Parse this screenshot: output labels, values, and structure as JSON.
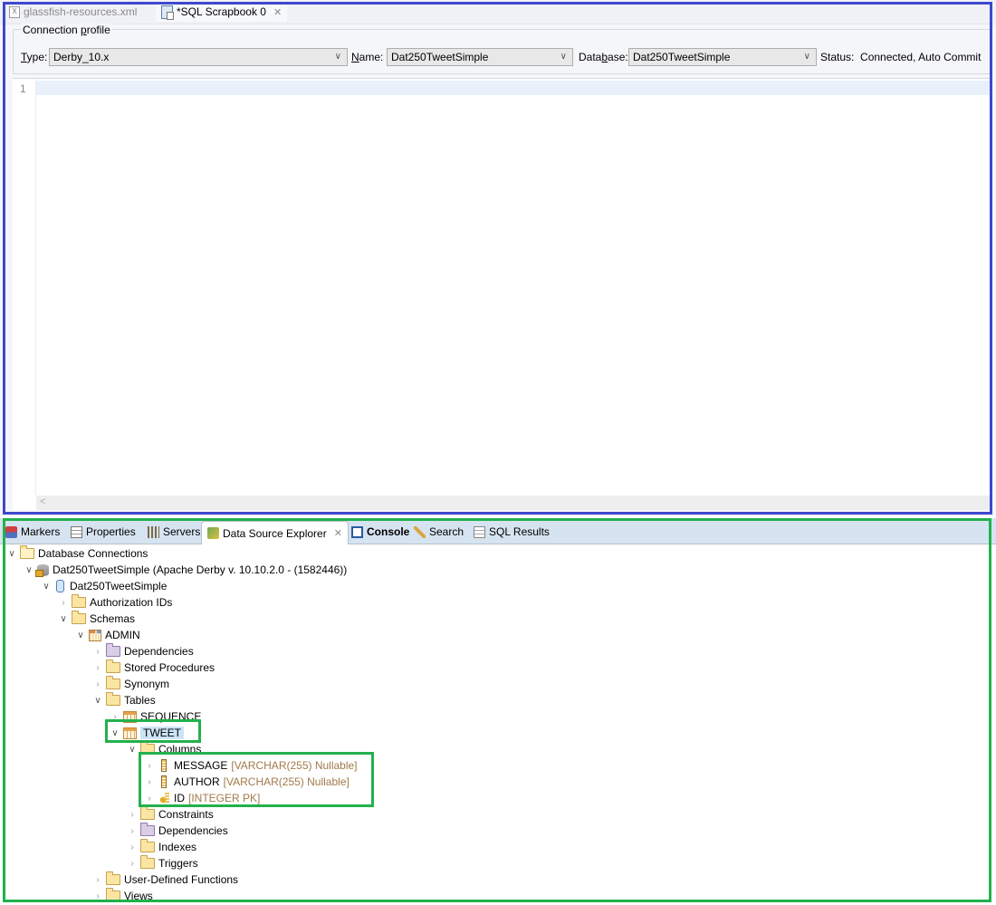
{
  "editor": {
    "tabs": [
      {
        "label": "glassfish-resources.xml",
        "icon": "xml-file-icon",
        "active": false
      },
      {
        "label": "*SQL Scrapbook 0",
        "icon": "sql-scrapbook-icon",
        "active": true,
        "closable": true
      }
    ],
    "connection_profile": {
      "legend": "Connection profile",
      "type_label": "Type:",
      "type_value": "Derby_10.x",
      "name_label": "Name:",
      "name_value": "Dat250TweetSimple",
      "database_label": "Database:",
      "database_value": "Dat250TweetSimple",
      "status_label": "Status:",
      "status_value": "Connected, Auto Commit"
    },
    "line_numbers": [
      "1"
    ],
    "scroll_left_glyph": "<"
  },
  "views": {
    "tabs": [
      {
        "label": "Markers",
        "icon": "markers-icon"
      },
      {
        "label": "Properties",
        "icon": "properties-icon"
      },
      {
        "label": "Servers",
        "icon": "servers-icon"
      },
      {
        "label": "Data Source Explorer",
        "icon": "data-source-explorer-icon",
        "active": true,
        "closable": true
      },
      {
        "label": "Console",
        "icon": "console-icon",
        "bold": true
      },
      {
        "label": "Search",
        "icon": "search-icon"
      },
      {
        "label": "SQL Results",
        "icon": "sql-results-icon"
      }
    ],
    "tree": [
      {
        "label": "Database Connections",
        "depth": 0,
        "expanded": true,
        "icon": "folder-open"
      },
      {
        "label": "Dat250TweetSimple (Apache Derby v. 10.10.2.0 - (1582446))",
        "depth": 1,
        "expanded": true,
        "icon": "db-connection"
      },
      {
        "label": "Dat250TweetSimple",
        "depth": 2,
        "expanded": true,
        "icon": "database"
      },
      {
        "label": "Authorization IDs",
        "depth": 3,
        "expanded": false,
        "icon": "folder"
      },
      {
        "label": "Schemas",
        "depth": 3,
        "expanded": true,
        "icon": "folder"
      },
      {
        "label": "ADMIN",
        "depth": 4,
        "expanded": true,
        "icon": "schema"
      },
      {
        "label": "Dependencies",
        "depth": 5,
        "expanded": false,
        "icon": "folder-purple"
      },
      {
        "label": "Stored Procedures",
        "depth": 5,
        "expanded": false,
        "icon": "folder"
      },
      {
        "label": "Synonym",
        "depth": 5,
        "expanded": false,
        "icon": "folder"
      },
      {
        "label": "Tables",
        "depth": 5,
        "expanded": true,
        "icon": "folder"
      },
      {
        "label": "SEQUENCE",
        "depth": 6,
        "expanded": false,
        "icon": "table"
      },
      {
        "label": "TWEET",
        "depth": 6,
        "expanded": true,
        "icon": "table",
        "selected": true
      },
      {
        "label": "Columns",
        "depth": 7,
        "expanded": true,
        "icon": "folder"
      },
      {
        "label": "MESSAGE",
        "type": "[VARCHAR(255) Nullable]",
        "depth": 8,
        "expanded": false,
        "icon": "column"
      },
      {
        "label": "AUTHOR",
        "type": "[VARCHAR(255) Nullable]",
        "depth": 8,
        "expanded": false,
        "icon": "column"
      },
      {
        "label": "ID",
        "type": "[INTEGER PK]",
        "depth": 8,
        "expanded": false,
        "icon": "pk-column"
      },
      {
        "label": "Constraints",
        "depth": 7,
        "expanded": false,
        "icon": "folder"
      },
      {
        "label": "Dependencies",
        "depth": 7,
        "expanded": false,
        "icon": "folder-purple"
      },
      {
        "label": "Indexes",
        "depth": 7,
        "expanded": false,
        "icon": "folder"
      },
      {
        "label": "Triggers",
        "depth": 7,
        "expanded": false,
        "icon": "folder"
      },
      {
        "label": "User-Defined Functions",
        "depth": 5,
        "expanded": false,
        "icon": "folder"
      },
      {
        "label": "Views",
        "depth": 5,
        "expanded": false,
        "icon": "folder"
      }
    ]
  },
  "annotations": {
    "editor_frame_color": "#3f48cc",
    "explorer_frame_color": "#22b14c",
    "highlight_color": "#22b14c"
  }
}
